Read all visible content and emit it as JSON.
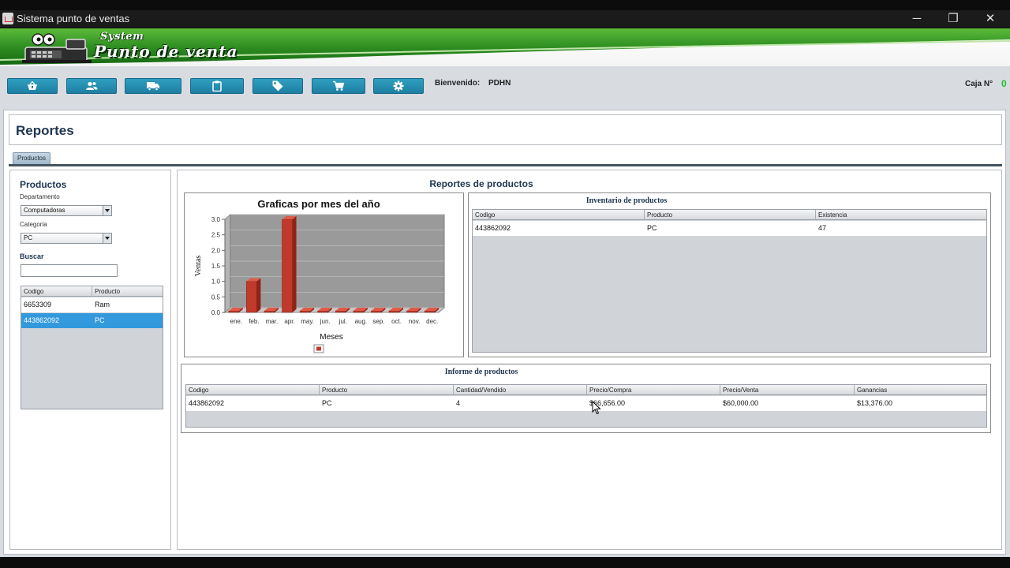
{
  "window": {
    "title": "Sistema punto de ventas",
    "controls": {
      "minimize": "─",
      "maximize": "❐",
      "close": "✕"
    }
  },
  "banner": {
    "system_text": "System",
    "title_text": "Punto de venta"
  },
  "toolbar": {
    "buttons": [
      {
        "name": "basket-icon"
      },
      {
        "name": "users-icon"
      },
      {
        "name": "truck-icon"
      },
      {
        "name": "clipboard-icon"
      },
      {
        "name": "tag-icon"
      },
      {
        "name": "cart-icon"
      },
      {
        "name": "gear-icon"
      }
    ],
    "button_color": "#2490b5",
    "welcome_label": "Bienvenido:",
    "user": "PDHN",
    "caja_label": "Caja  N°",
    "caja_number": "0"
  },
  "page": {
    "title": "Reportes",
    "tab_label": "Productos"
  },
  "left": {
    "heading": "Productos",
    "department_label": "Departamento",
    "department_value": "Computadoras",
    "category_label": "Categoria",
    "category_value": "PC",
    "search_label": "Buscar",
    "search_value": "",
    "table": {
      "headers": [
        "Codigo",
        "Producto"
      ],
      "rows": [
        {
          "codigo": "6653309",
          "producto": "Ram"
        },
        {
          "codigo": "443862092",
          "producto": "PC"
        }
      ]
    }
  },
  "right": {
    "title": "Reportes de productos",
    "chart_title": "Graficas por mes del año",
    "inventory": {
      "title": "Inventario de productos",
      "headers": [
        "Codigo",
        "Producto",
        "Existencia"
      ],
      "rows": [
        {
          "codigo": "443862092",
          "producto": "PC",
          "existencia": "47"
        }
      ]
    },
    "report": {
      "title": "Informe de productos",
      "headers": [
        "Codigo",
        "Producto",
        "Cantidad/Vendido",
        "Precio/Compra",
        "Precio/Venta",
        "Ganancias"
      ],
      "rows": [
        {
          "codigo": "443862092",
          "producto": "PC",
          "cantidad": "4",
          "compra": "$66,656.00",
          "venta": "$60,000.00",
          "ganancias": "$13,376.00"
        }
      ]
    }
  },
  "chart_data": {
    "type": "bar",
    "title": "Graficas por mes del año",
    "xlabel": "Meses",
    "ylabel": "Ventas",
    "categories": [
      "ene.",
      "feb.",
      "mar.",
      "apr.",
      "may.",
      "jun.",
      "jul.",
      "aug.",
      "sep.",
      "oct.",
      "nov.",
      "dec."
    ],
    "values": [
      0,
      1,
      0,
      3,
      0,
      0,
      0,
      0,
      0,
      0,
      0,
      0
    ],
    "ylim": [
      0,
      3.0
    ],
    "yticks": [
      "0.0",
      "0.5",
      "1.0",
      "1.5",
      "2.0",
      "2.5",
      "3.0"
    ],
    "grid": true,
    "legend": "bottom",
    "bar_color": "#c0392b",
    "plot_bg": "#9a9a9a"
  }
}
